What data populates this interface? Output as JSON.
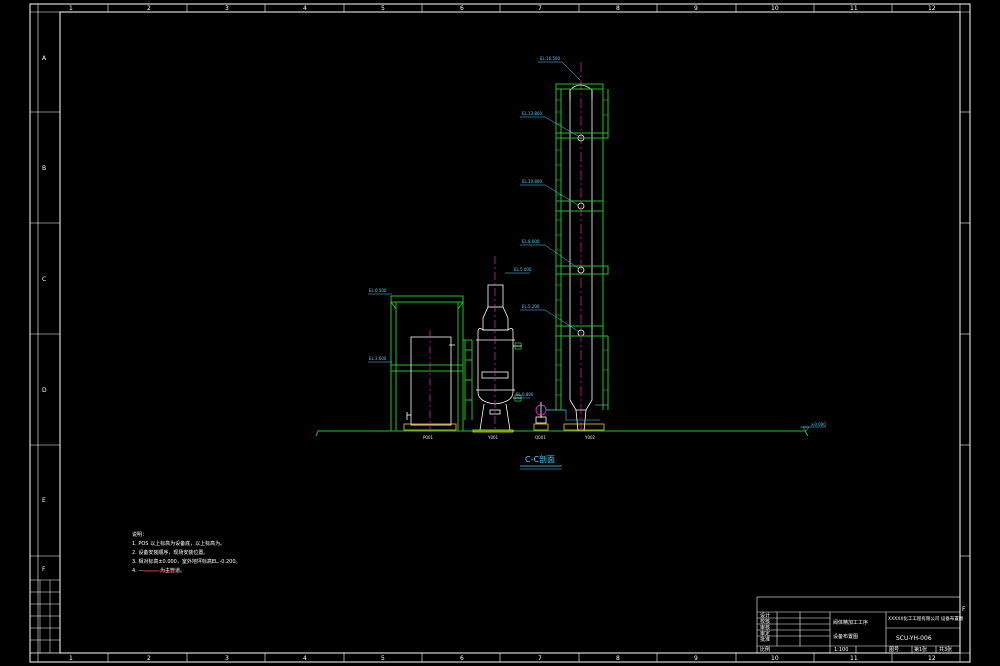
{
  "frame": {
    "column_numbers": [
      "1",
      "2",
      "3",
      "4",
      "5",
      "6",
      "7",
      "8",
      "9",
      "10",
      "11",
      "12"
    ],
    "row_letters": [
      "A",
      "B",
      "C",
      "D",
      "E",
      "F"
    ],
    "right_letter": "F"
  },
  "section": {
    "title": "C-C剖面",
    "elevation_label": "±0.000"
  },
  "equipment_tags": [
    "P001",
    "Y001",
    "Q001",
    "Y002"
  ],
  "elevation_tags": {
    "frame_top": "EL.6.500",
    "frame_mid": "EL.3.600",
    "vessel_top": "EL.5.000",
    "vessel_nozzle": "EL.0.800",
    "column_levels": [
      "EL.16.500",
      "EL.13.800",
      "EL.10.800",
      "EL.8.000",
      "EL.5.200"
    ]
  },
  "notes": {
    "heading": "说明：",
    "items": [
      "1. POS 以上标高为设备底，以上标高为。",
      "2. 设备安装顺序，现场安装位置。",
      "3. 相对标高±0.000，室外地坪标高EL.-0.200。",
      "4. ———— 为主管道。"
    ]
  },
  "title_block": {
    "rows": [
      "设计",
      "校核",
      "审核",
      "审定",
      "批准"
    ],
    "project": "阀体精加工工序",
    "drawing_name": "设备布置图",
    "company": "XXXXX化工工程有限公司 设备布置图",
    "drawing_no": "SCU-YH-006",
    "bottom": [
      "比例",
      "1:100",
      "图号",
      "第1张",
      "共3张"
    ]
  },
  "colors": {
    "border": "#ffffff",
    "structure": "#22c02a",
    "equipment": "#ffffff",
    "centerline": "#ff2bd6",
    "dimension": "#4fd1ff",
    "note_red": "#ff3030"
  }
}
